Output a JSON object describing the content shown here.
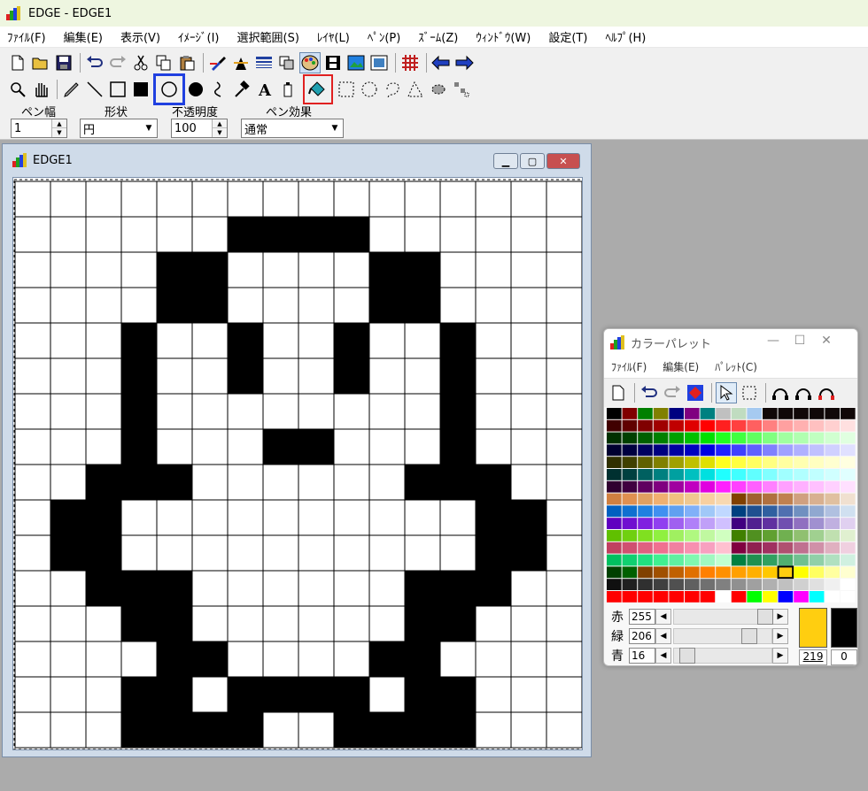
{
  "app": {
    "title": "EDGE - EDGE1"
  },
  "menu": [
    "ﾌｧｲﾙ(F)",
    "編集(E)",
    "表示(V)",
    "ｲﾒｰｼﾞ(I)",
    "選択範囲(S)",
    "ﾚｲﾔ(L)",
    "ﾍﾟﾝ(P)",
    "ｽﾞｰﾑ(Z)",
    "ｳｨﾝﾄﾞｳ(W)",
    "設定(T)",
    "ﾍﾙﾌﾟ(H)"
  ],
  "options": {
    "pen_width_label": "ペン幅",
    "pen_width_value": "1",
    "shape_label": "形状",
    "shape_value": "円",
    "opacity_label": "不透明度",
    "opacity_value": "100",
    "pen_effect_label": "ペン効果",
    "pen_effect_value": "通常"
  },
  "document": {
    "title": "EDGE1",
    "grid_cols": 16,
    "grid_rows": 16,
    "pixels": [
      "0000000000000000",
      "0000001111000000",
      "0000110000110000",
      "0000110000110000",
      "0001001001001000",
      "0001001001001000",
      "0001000000001000",
      "0001000110001000",
      "0011100000011100",
      "0110000000000110",
      "0110000000000110",
      "0011100000011100",
      "0001100000011000",
      "0000110000110000",
      "0001101111011000",
      "0001111001111000"
    ]
  },
  "palette": {
    "title": "カラーパレット",
    "menu": [
      "ﾌｧｲﾙ(F)",
      "編集(E)",
      "ﾊﾟﾚｯﾄ(C)"
    ],
    "colors": [
      [
        "#000000",
        "#800000",
        "#008000",
        "#808000",
        "#000080",
        "#800080",
        "#008080",
        "#c0c0c0",
        "#c0dcc0",
        "#a6caf0",
        "#100808",
        "#100808",
        "#100808",
        "#100808",
        "#100808",
        "#100808"
      ],
      [
        "#400000",
        "#600000",
        "#800000",
        "#a00000",
        "#c00000",
        "#e00000",
        "#ff0000",
        "#ff2020",
        "#ff4040",
        "#ff6060",
        "#ff8080",
        "#ffa0a0",
        "#ffb0b0",
        "#ffc0c0",
        "#ffd0d0",
        "#ffe0e0"
      ],
      [
        "#003000",
        "#004000",
        "#006000",
        "#008000",
        "#00a000",
        "#00c000",
        "#00e000",
        "#20ff20",
        "#40ff40",
        "#60ff60",
        "#80ff80",
        "#a0ffa0",
        "#b0ffb0",
        "#c0ffc0",
        "#d0ffd0",
        "#e0ffe0"
      ],
      [
        "#000030",
        "#000040",
        "#000060",
        "#000080",
        "#0000a0",
        "#0000c0",
        "#0000e0",
        "#2020ff",
        "#4040ff",
        "#6060ff",
        "#8080ff",
        "#a0a0ff",
        "#b0b0ff",
        "#c0c0ff",
        "#d0d0ff",
        "#e0e0ff"
      ],
      [
        "#303000",
        "#404000",
        "#606000",
        "#808000",
        "#a0a000",
        "#c0c000",
        "#e0e000",
        "#ffff20",
        "#ffff40",
        "#ffff60",
        "#ffff80",
        "#ffffa0",
        "#ffffb0",
        "#ffffc0",
        "#ffffd0",
        "#ffffe0"
      ],
      [
        "#003030",
        "#004040",
        "#006060",
        "#008080",
        "#00a0a0",
        "#00c0c0",
        "#00e0e0",
        "#20ffff",
        "#40ffff",
        "#60ffff",
        "#80ffff",
        "#a0ffff",
        "#b0ffff",
        "#c0ffff",
        "#d0ffff",
        "#e0ffff"
      ],
      [
        "#300030",
        "#400040",
        "#600060",
        "#800080",
        "#a000a0",
        "#c000c0",
        "#e000e0",
        "#ff20ff",
        "#ff40ff",
        "#ff60ff",
        "#ff80ff",
        "#ffa0ff",
        "#ffb0ff",
        "#ffc0ff",
        "#ffd0ff",
        "#ffe0ff"
      ],
      [
        "#d08040",
        "#e09050",
        "#e0a060",
        "#f0b070",
        "#f0c080",
        "#f0c890",
        "#f8d0a0",
        "#f8d8b0",
        "#804000",
        "#a06030",
        "#b07040",
        "#c08050",
        "#d0a080",
        "#d8b090",
        "#e0c0a0",
        "#f0e0d0"
      ],
      [
        "#0060c0",
        "#1070d0",
        "#2080e0",
        "#4090f0",
        "#60a0f0",
        "#80b0f8",
        "#a0c8f8",
        "#c0d8ff",
        "#004080",
        "#205090",
        "#3060a0",
        "#5070b0",
        "#7090c0",
        "#90a8d0",
        "#b0c0e0",
        "#d0e0f0"
      ],
      [
        "#6000c0",
        "#7010d0",
        "#8020e0",
        "#9040f0",
        "#a060f0",
        "#b080f8",
        "#c0a0f8",
        "#d0c0ff",
        "#400080",
        "#502090",
        "#6030a0",
        "#7050b0",
        "#9070c0",
        "#a090d0",
        "#c0b0e0",
        "#e0d0f0"
      ],
      [
        "#60c000",
        "#70d010",
        "#80e020",
        "#90f040",
        "#a0f060",
        "#b0f880",
        "#c0f8a0",
        "#d0ffc0",
        "#408000",
        "#509020",
        "#60a030",
        "#70b050",
        "#90c070",
        "#a0d090",
        "#c0e0b0",
        "#e0f0d0"
      ],
      [
        "#c04060",
        "#d05070",
        "#e06080",
        "#f07090",
        "#f080a0",
        "#f890b0",
        "#f8a0c0",
        "#ffc0d0",
        "#800040",
        "#902050",
        "#a03060",
        "#b05070",
        "#c07090",
        "#d090a8",
        "#e0b0c0",
        "#f0d0e0"
      ],
      [
        "#00c060",
        "#10d070",
        "#20e080",
        "#40f090",
        "#60f0a0",
        "#80f8b0",
        "#a0f8c0",
        "#c0ffd0",
        "#008040",
        "#209050",
        "#30a060",
        "#50b070",
        "#70c090",
        "#90d0a8",
        "#b0e0c0",
        "#d0f0e0"
      ],
      [
        "#004000",
        "#006000",
        "#804000",
        "#a05000",
        "#c06000",
        "#e07000",
        "#ff8000",
        "#ff9000",
        "#ffa000",
        "#ffb000",
        "#ffc800",
        "#ffd000",
        "#ffff00",
        "#ffff60",
        "#ffffa0",
        "#ffffd0"
      ],
      [
        "#101010",
        "#202020",
        "#303030",
        "#404040",
        "#505050",
        "#606060",
        "#707070",
        "#808080",
        "#909090",
        "#a0a0a0",
        "#b0b0b0",
        "#c0c0c0",
        "#d0d0d0",
        "#e0e0e0",
        "#f0f0f0",
        "#ffffff"
      ],
      [
        "#ff0000",
        "#ff0000",
        "#ff0000",
        "#ff0000",
        "#ff0000",
        "#ff0000",
        "#ff0000",
        "#ffffff",
        "#ff0000",
        "#00ff00",
        "#ffff00",
        "#0000ff",
        "#ff00ff",
        "#00ffff",
        "#ffffff",
        "#ffffff"
      ]
    ],
    "selected_index": 219,
    "sliders": [
      {
        "label": "赤",
        "value": "255",
        "fraction": 1.0
      },
      {
        "label": "緑",
        "value": "206",
        "fraction": 0.81
      },
      {
        "label": "青",
        "value": "16",
        "fraction": 0.06
      }
    ],
    "foreground_color": "#ffce10",
    "background_color": "#000000",
    "foreground_index": "219",
    "background_index": "0"
  },
  "colors": {
    "highlight_blue": "#2040e0",
    "highlight_red": "#e02020"
  }
}
